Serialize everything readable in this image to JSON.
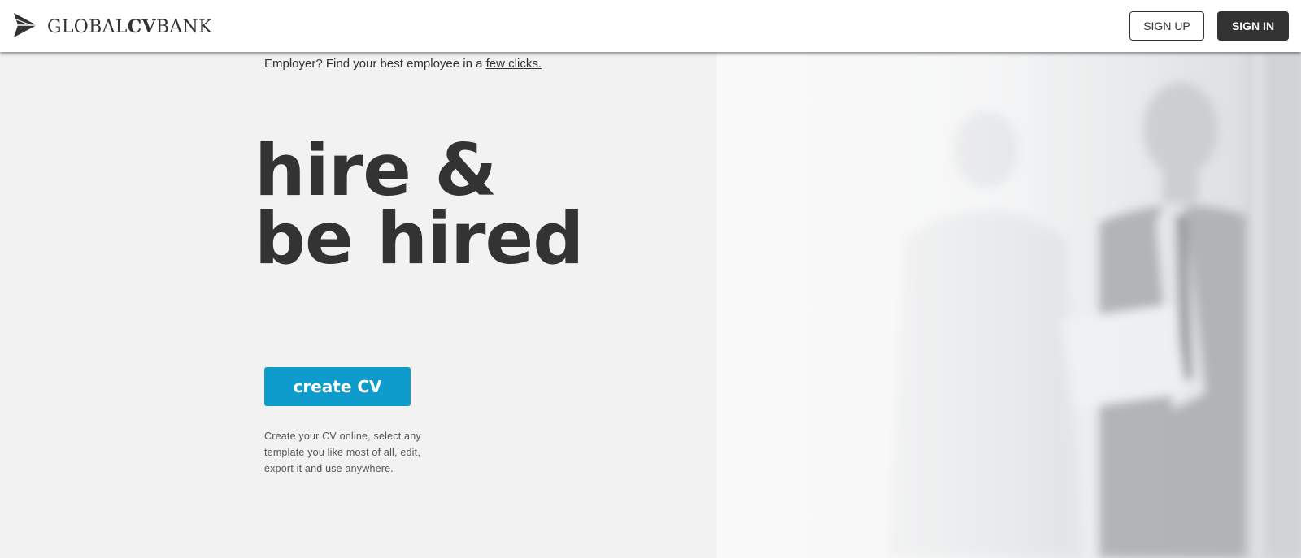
{
  "header": {
    "logo": {
      "icon": "paper-plane-icon",
      "text_prefix": "GLOBAL",
      "text_bold": "CV",
      "text_suffix": "BANK"
    },
    "signup_label": "SIGN UP",
    "signin_label": "SIGN IN"
  },
  "hero": {
    "employer_text": "Employer? Find your best employee in a ",
    "employer_link": "few clicks.",
    "headline_line1": "hire &",
    "headline_line2": "be hired",
    "cta_label": "create CV",
    "description": "Create your CV online, select any template you like most of all, edit, export it and use anywhere."
  },
  "colors": {
    "accent": "#0e9ccc",
    "dark": "#333333",
    "background": "#f2f2f2"
  }
}
